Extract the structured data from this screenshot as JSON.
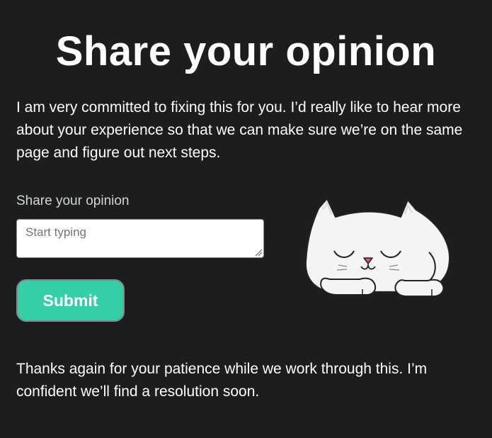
{
  "page": {
    "title": "Share your opinion",
    "intro": "I am very committed to fixing this for you. I’d really like to hear more about your experience so that we can make sure we’re on the same page and figure out next steps.",
    "outro": "Thanks again for your patience while we work through this. I’m confident we’ll find a resolution soon."
  },
  "form": {
    "label": "Share your opinion",
    "placeholder": "Start typing",
    "value": "",
    "submit_label": "Submit"
  },
  "colors": {
    "background": "#1b1d1f",
    "text": "#ffffff",
    "accent": "#34cfa8",
    "cat_nose": "#f0466e"
  },
  "illustration": {
    "name": "sleeping-cat-illustration"
  }
}
